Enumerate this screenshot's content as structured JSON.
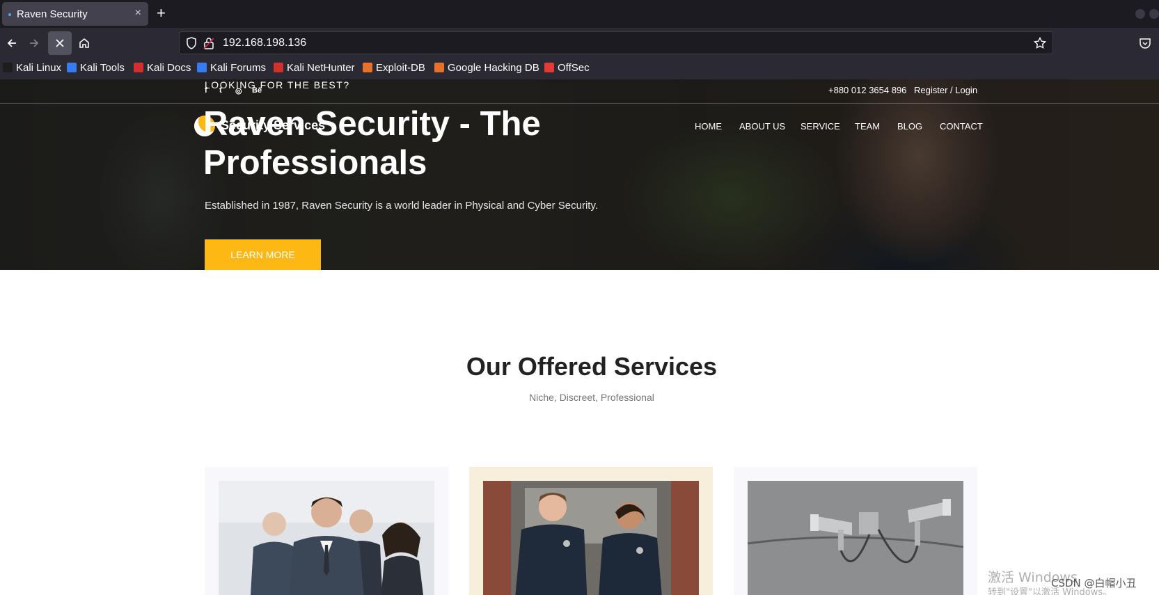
{
  "browser": {
    "tab_title": "Raven Security",
    "tab_close": "×",
    "new_tab": "+",
    "url": "192.168.198.136",
    "bookmarks": [
      {
        "label": "Kali Linux",
        "icon": "kali-dragon-icon",
        "color": "#1e1e1e"
      },
      {
        "label": "Kali Tools",
        "icon": "kali-tools-icon",
        "color": "#367bf0"
      },
      {
        "label": "Kali Docs",
        "icon": "kali-docs-icon",
        "color": "#d32f2f"
      },
      {
        "label": "Kali Forums",
        "icon": "kali-forums-icon",
        "color": "#367bf0"
      },
      {
        "label": "Kali NetHunter",
        "icon": "nethunter-icon",
        "color": "#d32f2f"
      },
      {
        "label": "Exploit-DB",
        "icon": "exploitdb-icon",
        "color": "#e8702a"
      },
      {
        "label": "Google Hacking DB",
        "icon": "ghdb-icon",
        "color": "#e8702a"
      },
      {
        "label": "OffSec",
        "icon": "offsec-icon",
        "color": "#e53935"
      }
    ]
  },
  "site": {
    "tagline": "LOOKING FOR THE BEST?",
    "social": [
      "f",
      "t",
      "◎",
      "Bē"
    ],
    "phone": "+880 012 3654 896",
    "login": "Register / Login",
    "logo_text": "Security Services",
    "nav": [
      "HOME",
      "ABOUT US",
      "SERVICE",
      "TEAM",
      "BLOG",
      "CONTACT"
    ],
    "hero_title": "Raven Security - The Professionals",
    "hero_subtitle": "Established in 1987, Raven Security is a world leader in Physical and Cyber Security.",
    "cta_label": "LEARN MORE",
    "accent_color": "#fdb813",
    "services_title": "Our Offered Services",
    "services_subtitle": "Niche, Discreet, Professional",
    "cards": [
      {
        "image": "business-team-photo"
      },
      {
        "image": "police-officers-photo"
      },
      {
        "image": "security-cameras-photo"
      }
    ]
  },
  "overlay": {
    "activate_windows": "激活 Windows",
    "activate_windows_sub": "转到\"设置\"以激活 Windows。",
    "csdn_credit": "CSDN @白帽小丑"
  }
}
